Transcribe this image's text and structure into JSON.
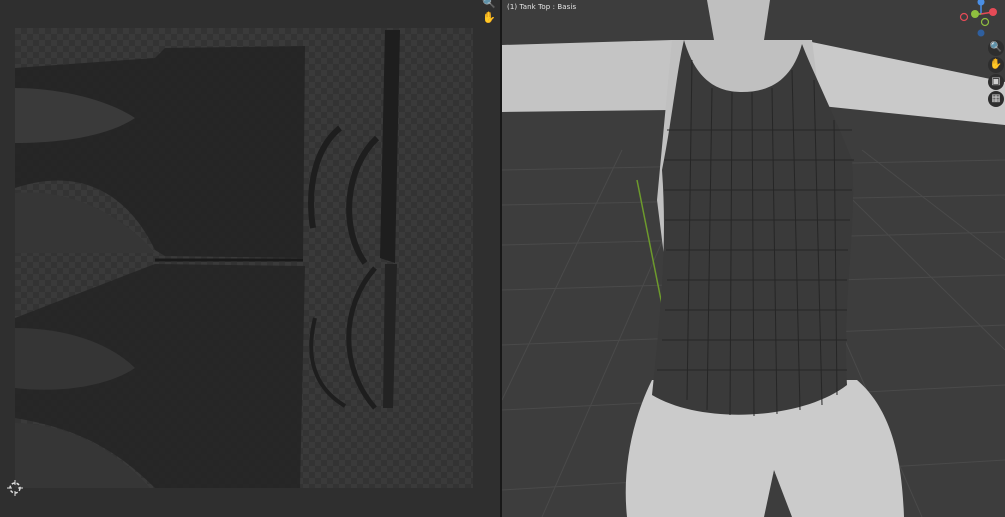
{
  "uv_editor": {
    "nav_icons": [
      "zoom-icon",
      "hand-icon"
    ],
    "cursor_icon": "2d-cursor-icon"
  },
  "viewport": {
    "label": "(1) Tank Top : Basis",
    "gizmo": {
      "axes": [
        "X",
        "Y",
        "Z"
      ],
      "colors": {
        "x": "#e54b57",
        "y": "#8fbf3f",
        "z": "#4a8fe6"
      }
    },
    "tools": [
      "zoom-icon",
      "hand-icon",
      "camera-icon",
      "grid-icon"
    ]
  },
  "colors": {
    "uv_background": "#2f2f2f",
    "viewport_background": "#3d3d3d",
    "garment": "#3a3a3a",
    "body": "#c9c9c9"
  }
}
